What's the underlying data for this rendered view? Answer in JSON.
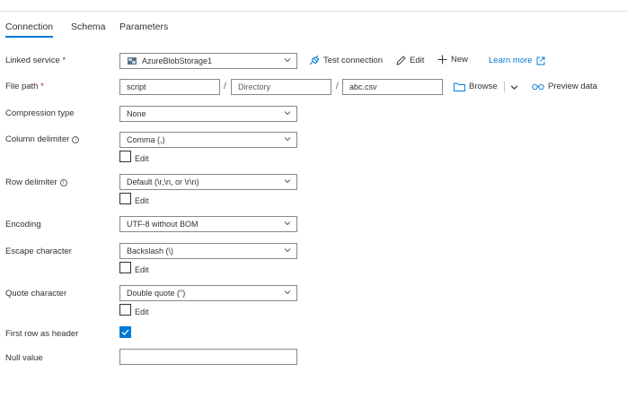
{
  "tabs": [
    {
      "label": "Connection"
    },
    {
      "label": "Schema"
    },
    {
      "label": "Parameters"
    }
  ],
  "linked_service": {
    "label": "Linked service",
    "required_mark": "*",
    "value": "AzureBlobStorage1",
    "test_connection": "Test connection",
    "edit": "Edit",
    "new": "New",
    "learn_more": "Learn more"
  },
  "file_path": {
    "label": "File path",
    "required_mark": "*",
    "container": "script",
    "directory": "Directory",
    "file": "abc.csv",
    "separator": "/",
    "browse": "Browse",
    "preview": "Preview data"
  },
  "compression_type": {
    "label": "Compression type",
    "value": "None"
  },
  "column_delimiter": {
    "label": "Column delimiter",
    "value": "Comma (,)",
    "edit_label": "Edit"
  },
  "row_delimiter": {
    "label": "Row delimiter",
    "value": "Default (\\r,\\n, or \\r\\n)",
    "edit_label": "Edit"
  },
  "encoding": {
    "label": "Encoding",
    "value": "UTF-8 without BOM"
  },
  "escape_character": {
    "label": "Escape character",
    "value": "Backslash (\\)",
    "edit_label": "Edit"
  },
  "quote_character": {
    "label": "Quote character",
    "value": "Double quote (\")",
    "edit_label": "Edit"
  },
  "first_row_header": {
    "label": "First row as header",
    "checked": true
  },
  "null_value": {
    "label": "Null value",
    "value": ""
  },
  "colors": {
    "accent": "#0078d4",
    "required": "#a4262c",
    "border": "#8a8886"
  }
}
